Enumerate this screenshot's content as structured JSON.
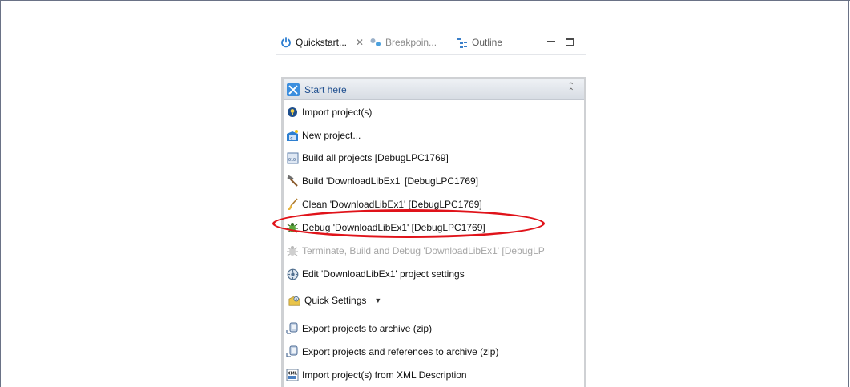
{
  "tabs": [
    {
      "label": "Quickstart...",
      "icon": "quickstart-power-icon",
      "close": "✕"
    },
    {
      "label": "Breakpoin...",
      "icon": "breakpoints-icon"
    },
    {
      "label": "Outline",
      "icon": "outline-icon"
    }
  ],
  "panel": {
    "header": {
      "title": "Start here",
      "icon": "start-here-icon",
      "collapse_icon": "double-chevron-up-icon"
    },
    "items": [
      {
        "label": "Import project(s)",
        "icon": "import-bulb-icon",
        "enabled": true
      },
      {
        "label": "New project...",
        "icon": "new-c-project-icon",
        "enabled": true
      },
      {
        "label": "Build all projects [DebugLPC1769]",
        "icon": "build-all-binary-icon",
        "enabled": true
      },
      {
        "label": "Build 'DownloadLibEx1' [DebugLPC1769]",
        "icon": "hammer-icon",
        "enabled": true
      },
      {
        "label": "Clean 'DownloadLibEx1' [DebugLPC1769]",
        "icon": "broom-icon",
        "enabled": true
      },
      {
        "label": "Debug 'DownloadLibEx1' [DebugLPC1769]",
        "icon": "debug-bug-icon",
        "enabled": true
      },
      {
        "label": "Terminate, Build and Debug 'DownloadLibEx1' [DebugLP",
        "icon": "debug-bug-disabled-icon",
        "enabled": false
      },
      {
        "label": "Edit 'DownloadLibEx1' project settings",
        "icon": "settings-gear-icon",
        "enabled": true
      },
      {
        "label": "Quick Settings",
        "icon": "quick-settings-icon",
        "enabled": true,
        "dropdown": "▼"
      },
      {
        "label": "Export projects to archive (zip)",
        "icon": "export-archive-icon",
        "enabled": true
      },
      {
        "label": "Export projects and references to archive (zip)",
        "icon": "export-archive-refs-icon",
        "enabled": true
      },
      {
        "label": "Import project(s) from XML Description",
        "icon": "xml-import-icon",
        "enabled": true,
        "icon_text": "XML"
      }
    ]
  },
  "annotation": {
    "highlight_color": "#e0131a",
    "highlighted_item": "Debug 'DownloadLibEx1' [DebugLPC1769]"
  },
  "colors": {
    "header_text": "#1f4f8f",
    "disabled_text": "#a6a6a6",
    "accent_blue": "#3b8ede"
  }
}
